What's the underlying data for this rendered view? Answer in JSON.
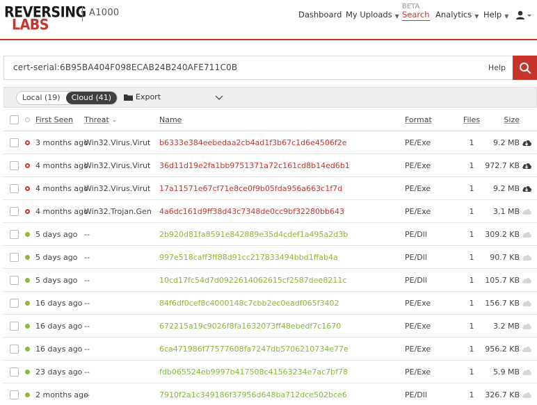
{
  "header": {
    "logo_top": "REVERSING",
    "logo_bottom": "LABS",
    "product": "A1000",
    "nav": {
      "dashboard": "Dashboard",
      "my_uploads": "My Uploads",
      "search_beta": "BETA",
      "search": "Search",
      "analytics": "Analytics",
      "help": "Help"
    }
  },
  "search": {
    "query": "cert-serial:6B95BA404F098ECAB24B240AFE711C0B",
    "help_label": "Help"
  },
  "toolbar": {
    "local_label": "Local (19)",
    "cloud_label": "Cloud (41)",
    "export_label": "Export"
  },
  "table": {
    "columns": {
      "first_seen": "First Seen",
      "threat": "Threat",
      "name": "Name",
      "format": "Format",
      "files": "Files",
      "size": "Size"
    },
    "rows": [
      {
        "status": "malicious",
        "first_seen": "3 months ago",
        "threat": "Win32.Virus.Virut",
        "name": "b6333e384eebedaa2cb4ad1f3b67c1d6e4506f2e",
        "format": "PE/Exe",
        "files": "1",
        "size": "9.2 MB",
        "cloud": "download"
      },
      {
        "status": "malicious",
        "first_seen": "4 months ago",
        "threat": "Win32.Virus.Virut",
        "name": "36d11d19e2fa1bb9751371a72c161cd8b14ed6b1",
        "format": "PE/Exe",
        "files": "1",
        "size": "972.7 KB",
        "cloud": "download"
      },
      {
        "status": "malicious",
        "first_seen": "4 months ago",
        "threat": "Win32.Virus.Virut",
        "name": "17a11571e67cf71e8ce0f9b05fda956a663c1f7d",
        "format": "PE/Exe",
        "files": "1",
        "size": "9.2 MB",
        "cloud": "download"
      },
      {
        "status": "malicious",
        "first_seen": "4 months ago",
        "threat": "Win32.Trojan.Gen",
        "name": "4a6dc161d9ff38d43c7348de0cc9bf32280bb643",
        "format": "PE/Exe",
        "files": "1",
        "size": "3.1 MB",
        "cloud": "none"
      },
      {
        "status": "known",
        "first_seen": "5 days ago",
        "threat": "--",
        "name": "2b920d81fa8591e842889e35d4cdef1a495a2d3b",
        "format": "PE/Dll",
        "files": "1",
        "size": "309.2 KB",
        "cloud": "none"
      },
      {
        "status": "known",
        "first_seen": "5 days ago",
        "threat": "--",
        "name": "997e518caff3ff88d91cc217833494bbd1ffab4a",
        "format": "PE/Dll",
        "files": "1",
        "size": "90.7 KB",
        "cloud": "none"
      },
      {
        "status": "known",
        "first_seen": "5 days ago",
        "threat": "--",
        "name": "10cd17fc54d7d0922614062615cf2587dee8211c",
        "format": "PE/Dll",
        "files": "1",
        "size": "105.7 KB",
        "cloud": "none"
      },
      {
        "status": "known",
        "first_seen": "16 days ago",
        "threat": "--",
        "name": "84f6df0cef8c4000148c7cbb2ec0eadf065f3402",
        "format": "PE/Exe",
        "files": "1",
        "size": "156.7 KB",
        "cloud": "none"
      },
      {
        "status": "known",
        "first_seen": "16 days ago",
        "threat": "--",
        "name": "672215a19c9026f8fa1632073ff48ebedf7c1670",
        "format": "PE/Exe",
        "files": "1",
        "size": "3.2 MB",
        "cloud": "none"
      },
      {
        "status": "known",
        "first_seen": "16 days ago",
        "threat": "--",
        "name": "6ca471986f77577608fa7247db5706210734e77e",
        "format": "PE/Exe",
        "files": "1",
        "size": "956.2 KB",
        "cloud": "none"
      },
      {
        "status": "known",
        "first_seen": "23 days ago",
        "threat": "--",
        "name": "fdb065524eb9997b417508c41563234e7ac7bf78",
        "format": "PE/Exe",
        "files": "1",
        "size": "5.9 MB",
        "cloud": "none"
      },
      {
        "status": "known",
        "first_seen": "2 months ago",
        "threat": "--",
        "name": "7910f2a1c349186f37956d648ba712dce502bce6",
        "format": "PE/Dll",
        "files": "1",
        "size": "326.7 KB",
        "cloud": "none"
      }
    ]
  },
  "colors": {
    "brand_red": "#c8342a",
    "known_green": "#8fb73e",
    "cloud_dark": "#3a3a3a",
    "cloud_light": "#d6d6d6"
  }
}
